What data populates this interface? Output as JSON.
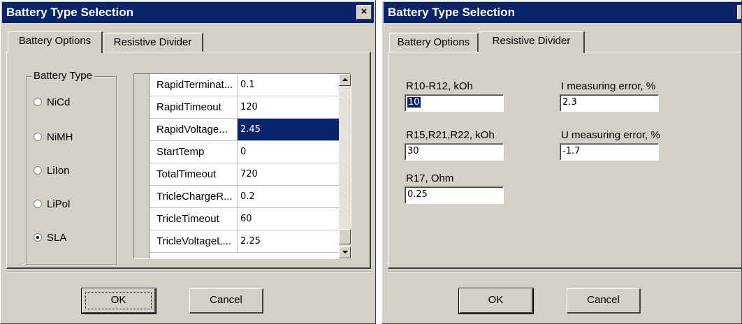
{
  "dialog_left": {
    "title": "Battery Type Selection",
    "close_glyph": "×",
    "tabs": [
      {
        "label": "Battery Options",
        "active": true
      },
      {
        "label": "Resistive Divider",
        "active": false
      }
    ],
    "battery_type_group": {
      "label": "Battery Type",
      "options": [
        {
          "label": "NiCd",
          "selected": false
        },
        {
          "label": "NiMH",
          "selected": false
        },
        {
          "label": "LiIon",
          "selected": false
        },
        {
          "label": "LiPol",
          "selected": false
        },
        {
          "label": "SLA",
          "selected": true
        }
      ]
    },
    "parameters_grid": {
      "rows": [
        {
          "name": "RapidTerminat...",
          "value": "0.1"
        },
        {
          "name": "RapidTimeout",
          "value": "120"
        },
        {
          "name": "RapidVoltage...",
          "value": "2.45",
          "selected": true
        },
        {
          "name": "StartTemp",
          "value": "0"
        },
        {
          "name": "TotalTimeout",
          "value": "720"
        },
        {
          "name": "TricleChargeR...",
          "value": "0.2"
        },
        {
          "name": "TricleTimeout",
          "value": "60"
        },
        {
          "name": "TricleVoltageL...",
          "value": "2.25"
        }
      ]
    },
    "buttons": {
      "ok": "OK",
      "cancel": "Cancel"
    }
  },
  "dialog_right": {
    "title": "Battery Type Selection",
    "close_glyph": "×",
    "tabs": [
      {
        "label": "Battery Options",
        "active": false
      },
      {
        "label": "Resistive Divider",
        "active": true
      }
    ],
    "fields": {
      "r10_r12": {
        "label": "R10-R12, kOh",
        "value": "10"
      },
      "i_error": {
        "label": "I measuring error, %",
        "value": "2.3"
      },
      "r15_r21_r22": {
        "label": "R15,R21,R22, kOh",
        "value": "30"
      },
      "u_error": {
        "label": "U measuring error, %",
        "value": "-1.7"
      },
      "r17": {
        "label": "R17, Ohm",
        "value": "0.25"
      }
    },
    "buttons": {
      "ok": "OK",
      "cancel": "Cancel"
    }
  },
  "colors": {
    "face": "#d4d0c8",
    "titlebar": "#0a246a",
    "selection": "#0a246a"
  }
}
